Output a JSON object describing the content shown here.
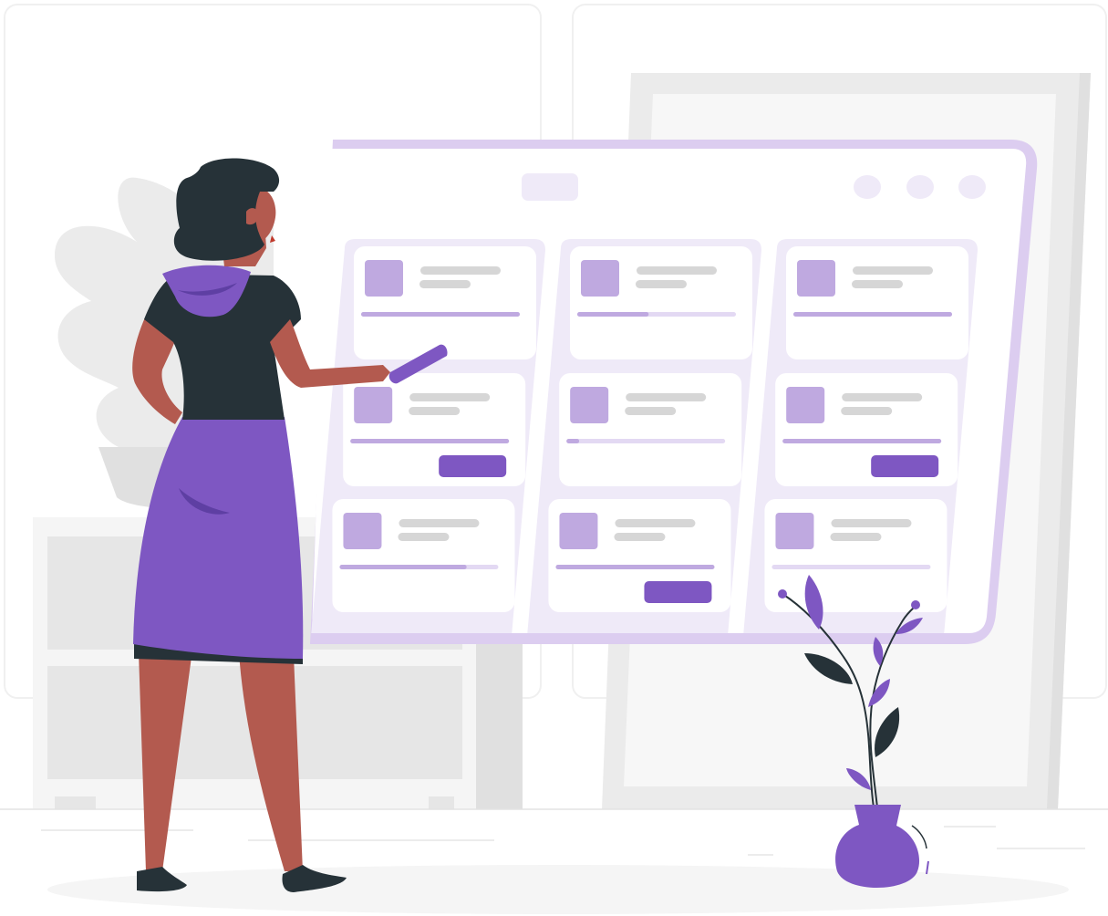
{
  "illustration": {
    "scene": "person-at-kanban-board",
    "colors": {
      "accent": "#7e57c2",
      "accent_light": "#bfa9e0",
      "accent_pale": "#efeaf8",
      "board_frame": "#dccdf0",
      "skin": "#b35a4f",
      "dark": "#263238",
      "gray_bg": "#ebebeb",
      "gray_light": "#f5f5f5",
      "gray_line": "#d6d6d6"
    }
  },
  "board": {
    "columns": [
      {
        "cards": [
          {
            "progress": 1.0,
            "has_button": false
          },
          {
            "progress": 1.0,
            "has_button": true
          },
          {
            "progress": 0.8,
            "has_button": false
          }
        ]
      },
      {
        "cards": [
          {
            "progress": 0.45,
            "has_button": false
          },
          {
            "progress": 0.08,
            "has_button": false
          },
          {
            "progress": 1.0,
            "has_button": true
          }
        ]
      },
      {
        "cards": [
          {
            "progress": 1.0,
            "has_button": false
          },
          {
            "progress": 1.0,
            "has_button": true
          },
          {
            "progress": 0.0,
            "has_button": false
          }
        ]
      }
    ],
    "window_dots": 3
  }
}
